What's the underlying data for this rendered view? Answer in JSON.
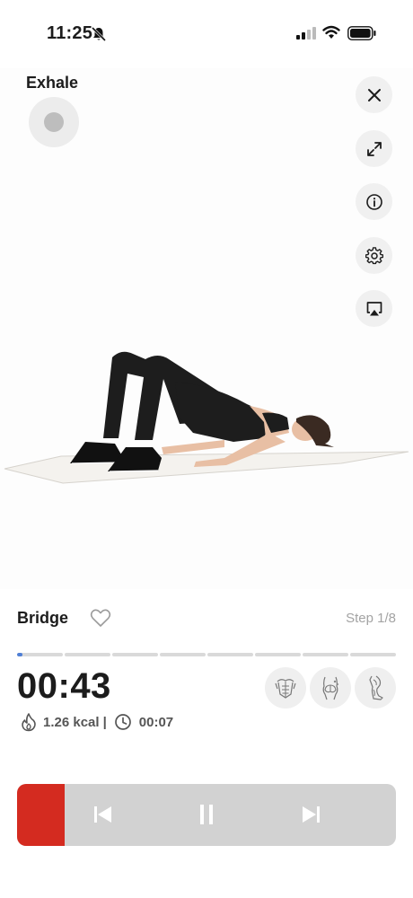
{
  "status_bar": {
    "time": "11:25",
    "icons": [
      "bell-slash-icon",
      "cellular-signal-icon",
      "wifi-icon",
      "battery-icon"
    ]
  },
  "breathing": {
    "label": "Exhale"
  },
  "side_controls": [
    "close-icon",
    "expand-icon",
    "info-icon",
    "settings-gear-icon",
    "airplay-icon"
  ],
  "exercise": {
    "name": "Bridge",
    "step": "Step 1/8",
    "favorite_icon": "heart-outline-icon"
  },
  "progress": {
    "segments": 8,
    "current_segment_fraction": 0.12
  },
  "timer": {
    "remaining": "00:43",
    "calories": "1.26 kcal",
    "separator": "|",
    "elapsed": "00:07"
  },
  "muscle_groups": [
    "abs-muscle-icon",
    "glutes-muscle-icon",
    "legs-muscle-icon"
  ],
  "player": {
    "progress_fraction": 0.125,
    "controls": [
      "skip-previous-icon",
      "pause-icon",
      "skip-next-icon"
    ]
  },
  "colors": {
    "accent_red": "#d42b20",
    "progress_blue": "#4f7fd6",
    "player_bg": "#d2d2d2"
  }
}
